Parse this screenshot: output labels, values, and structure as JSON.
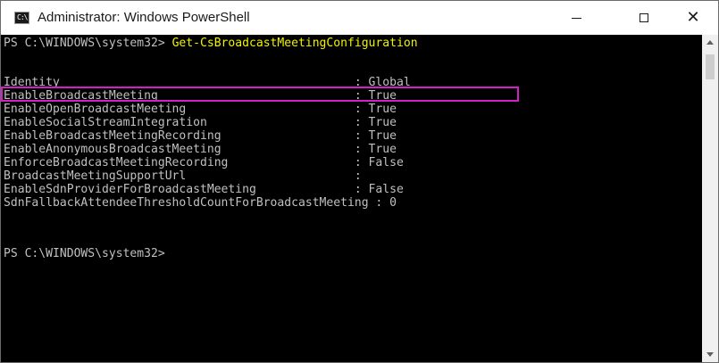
{
  "window": {
    "title": "Administrator: Windows PowerShell",
    "icon": "powershell-console-icon",
    "icon_glyph": "C:\\",
    "controls": {
      "minimize": "minimize-icon",
      "maximize": "maximize-icon",
      "close_glyph": "✕"
    }
  },
  "console": {
    "prompt": "PS C:\\WINDOWS\\system32> ",
    "command": "Get-CsBroadcastMeetingConfiguration",
    "output": [
      "Identity                                          : Global",
      "EnableBroadcastMeeting                            : True",
      "EnableOpenBroadcastMeeting                        : True",
      "EnableSocialStreamIntegration                     : True",
      "EnableBroadcastMeetingRecording                   : True",
      "EnableAnonymousBroadcastMeeting                   : True",
      "EnforceBroadcastMeetingRecording                  : False",
      "BroadcastMeetingSupportUrl                        :",
      "EnableSdnProviderForBroadcastMeeting              : False",
      "SdnFallbackAttendeeThresholdCountForBroadcastMeeting : 0"
    ],
    "final_prompt": "PS C:\\WINDOWS\\system32>",
    "highlighted_row": 1
  },
  "colors": {
    "background": "#000000",
    "text": "#c0c0c0",
    "command": "#f2f200",
    "highlight_border": "#d020c8",
    "titlebar": "#ffffff"
  }
}
